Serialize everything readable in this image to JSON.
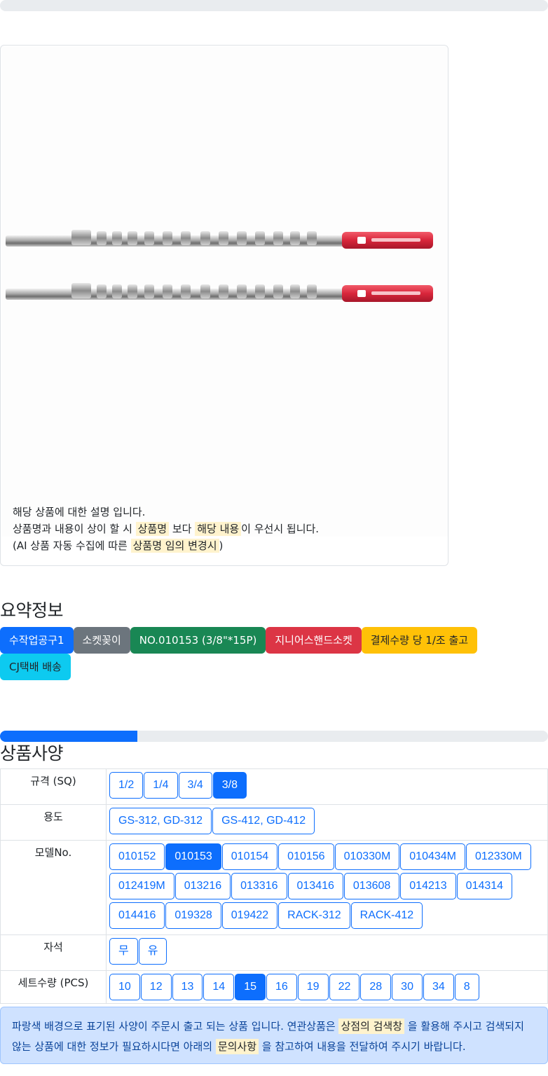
{
  "notice": {
    "line1": "해당 상품에 대한 설명 입니다.",
    "line2_pre": "상품명과 내용이 상이 할 시 ",
    "line2_hl1": "상품명",
    "line2_mid": " 보다 ",
    "line2_hl2": "해당 내용",
    "line2_post": "이 우선시 됩니다.",
    "line3_pre": "(AI 상품 자동 수집에 따른 ",
    "line3_hl": "상품명 임의 변경시",
    "line3_post": ")"
  },
  "summary": {
    "title": "요약정보",
    "badges": [
      {
        "label": "수작업공구1",
        "color": "#0d6efd"
      },
      {
        "label": "소켓꽂이",
        "color": "#6c757d"
      },
      {
        "label": "NO.010153 (3/8\"*15P)",
        "color": "#198754"
      },
      {
        "label": "지니어스핸드소켓",
        "color": "#dc3545"
      },
      {
        "label": "결제수량 당 1/조 출고",
        "color": "#ffc107"
      },
      {
        "label": "CJ택배 배송",
        "color": "#0dcaf0"
      }
    ]
  },
  "progress": {
    "value": 0.25
  },
  "spec": {
    "title": "상품사양",
    "rows": [
      {
        "label": "규격 (SQ)",
        "options": [
          "1/2",
          "1/4",
          "3/4",
          "3/8"
        ],
        "selected": "3/8"
      },
      {
        "label": "용도",
        "options": [
          "GS-312, GD-312",
          "GS-412, GD-412"
        ],
        "selected": ""
      },
      {
        "label": "모델No.",
        "options": [
          "010152",
          "010153",
          "010154",
          "010156",
          "010330M",
          "010434M",
          "012330M",
          "012419M",
          "013216",
          "013316",
          "013416",
          "013608",
          "014213",
          "014314",
          "014416",
          "019328",
          "019422",
          "RACK-312",
          "RACK-412"
        ],
        "selected": "010153"
      },
      {
        "label": "자석",
        "options": [
          "무",
          "유"
        ],
        "selected": ""
      },
      {
        "label": "세트수량 (PCS)",
        "options": [
          "10",
          "12",
          "13",
          "14",
          "15",
          "16",
          "19",
          "22",
          "28",
          "30",
          "34",
          "8"
        ],
        "selected": "15"
      }
    ]
  },
  "info": {
    "pre": "파랑색 배경으로 표기된 사양이 주문시 출고 되는 상품 입니다. 연관상품은 ",
    "hl1": "상점의 검색창",
    "mid": " 을 활용해 주시고 검색되지 않는 상품에 대한 정보가 필요하시다면 아래의 ",
    "hl2": "문의사항",
    "post": " 을 참고하여 내용을 전달하여 주시기 바랍니다."
  }
}
